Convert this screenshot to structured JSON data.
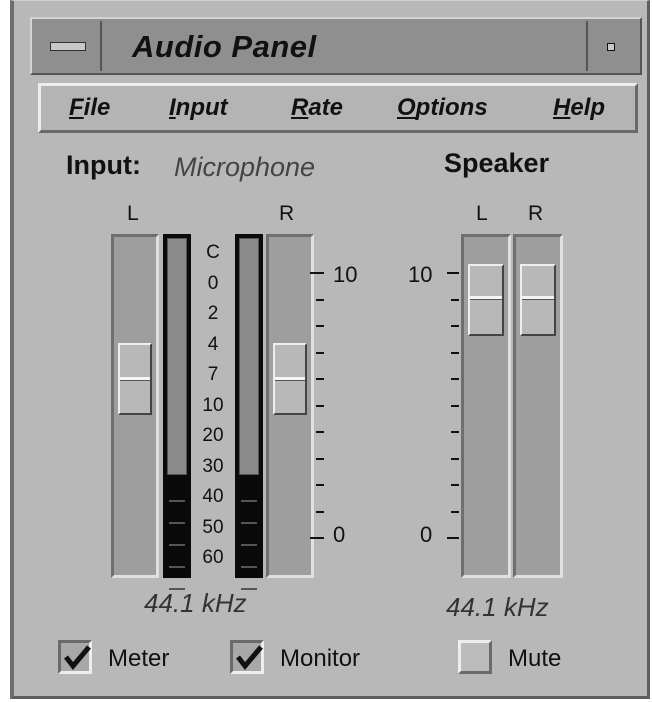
{
  "window": {
    "title": "Audio Panel",
    "system_menu_icon": "window-menu-icon",
    "minimize_icon": "minimize-icon"
  },
  "menu": {
    "items": [
      {
        "label": "File"
      },
      {
        "label": "Input"
      },
      {
        "label": "Rate"
      },
      {
        "label": "Options"
      },
      {
        "label": "Help"
      }
    ]
  },
  "input": {
    "label": "Input:",
    "source": "Microphone",
    "left_label": "L",
    "right_label": "R",
    "meter_scale": [
      "C",
      "0",
      "2",
      "4",
      "7",
      "10",
      "20",
      "30",
      "40",
      "50",
      "60"
    ],
    "gain_scale_top": "10",
    "gain_scale_bottom": "0",
    "left_gain": 0.6,
    "right_gain": 0.6,
    "left_meter_level": 0.3,
    "right_meter_level": 0.3,
    "rate": "44.1 kHz"
  },
  "speaker": {
    "label": "Speaker",
    "left_label": "L",
    "right_label": "R",
    "scale_top": "10",
    "scale_bottom": "0",
    "left_volume": 0.9,
    "right_volume": 0.9,
    "rate": "44.1 kHz"
  },
  "options": {
    "meter": {
      "label": "Meter",
      "checked": true
    },
    "monitor": {
      "label": "Monitor",
      "checked": true
    },
    "mute": {
      "label": "Mute",
      "checked": false
    }
  },
  "colors": {
    "window_bg": "#b8b8b8",
    "track_bg": "#9e9e9e",
    "meter_bg": "#0a0a0a"
  }
}
